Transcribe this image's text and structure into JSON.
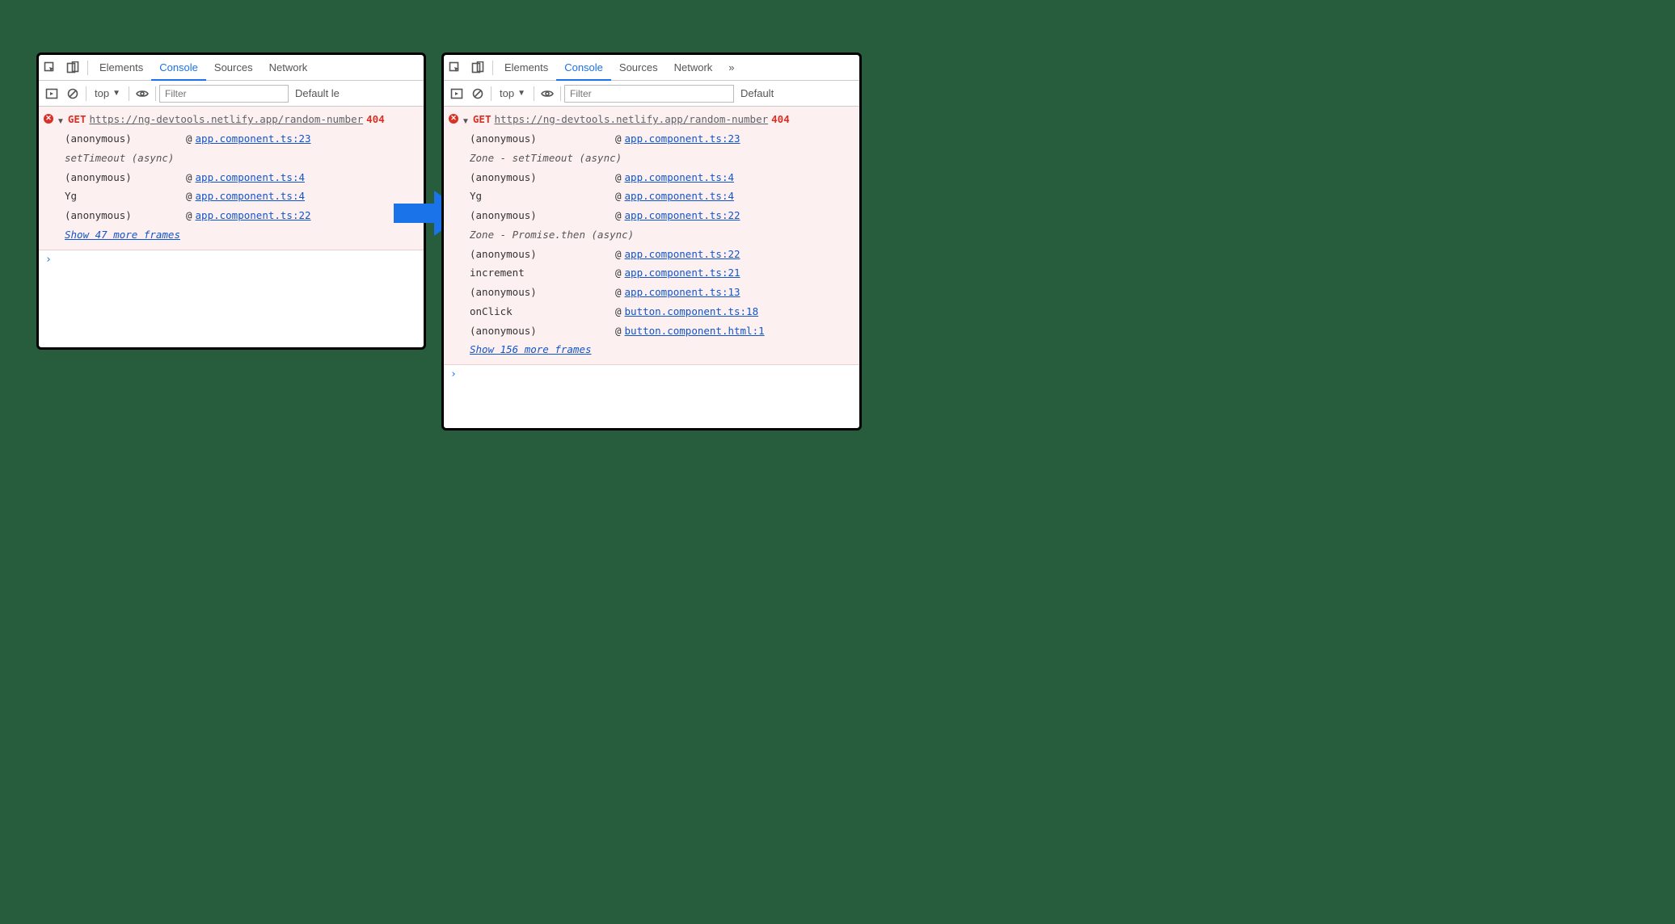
{
  "toolbar": {
    "tabs": {
      "elements": "Elements",
      "console": "Console",
      "sources": "Sources",
      "network": "Network"
    },
    "more_glyph": "»"
  },
  "filter": {
    "context": "top",
    "placeholder": "Filter",
    "levels_left": "Default le",
    "levels_right": "Default"
  },
  "left": {
    "method": "GET",
    "url": "https://ng-devtools.netlify.app/random-number",
    "status": "404",
    "meta1": "setTimeout (async)",
    "frames": [
      {
        "fn": "(anonymous)",
        "loc": "app.component.ts:23"
      },
      null,
      {
        "fn": "(anonymous)",
        "loc": "app.component.ts:4"
      },
      {
        "fn": "Yg",
        "loc": "app.component.ts:4"
      },
      {
        "fn": "(anonymous)",
        "loc": "app.component.ts:22"
      }
    ],
    "show_more": "Show 47 more frames"
  },
  "right": {
    "method": "GET",
    "url": "https://ng-devtools.netlify.app/random-number",
    "status": "404",
    "meta1": "Zone - setTimeout (async)",
    "meta2": "Zone - Promise.then (async)",
    "frames": [
      {
        "fn": "(anonymous)",
        "loc": "app.component.ts:23"
      },
      null,
      {
        "fn": "(anonymous)",
        "loc": "app.component.ts:4"
      },
      {
        "fn": "Yg",
        "loc": "app.component.ts:4"
      },
      {
        "fn": "(anonymous)",
        "loc": "app.component.ts:22"
      },
      null,
      {
        "fn": "(anonymous)",
        "loc": "app.component.ts:22"
      },
      {
        "fn": "increment",
        "loc": "app.component.ts:21"
      },
      {
        "fn": "(anonymous)",
        "loc": "app.component.ts:13"
      },
      {
        "fn": "onClick",
        "loc": "button.component.ts:18"
      },
      {
        "fn": "(anonymous)",
        "loc": "button.component.html:1"
      }
    ],
    "show_more": "Show 156 more frames"
  },
  "at_symbol": "@",
  "prompt": "›"
}
